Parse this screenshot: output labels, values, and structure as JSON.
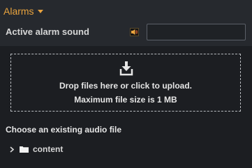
{
  "header": {
    "title": "Alarms"
  },
  "sound": {
    "label": "Active alarm sound",
    "input_value": ""
  },
  "upload": {
    "drop_text": "Drop files here or click to upload.",
    "size_text": "Maximum file size is 1 MB"
  },
  "existing": {
    "label": "Choose an existing audio file",
    "items": [
      {
        "label": "content",
        "icon": "folder-icon"
      }
    ]
  },
  "colors": {
    "accent": "#e8a33e",
    "background": "#26292e",
    "section_background": "#1c1e22"
  }
}
